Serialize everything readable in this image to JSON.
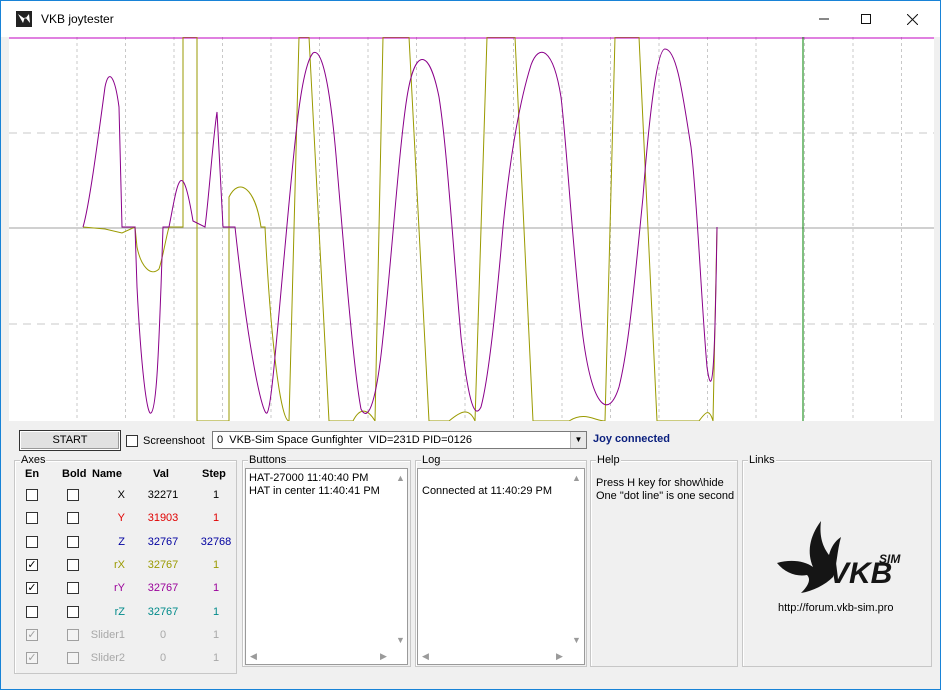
{
  "window": {
    "title": "VKB joytester",
    "minimize_glyph": "—",
    "maximize_glyph": "☐",
    "close_glyph": "✕"
  },
  "toolbar": {
    "start_label": "START",
    "screenshot_label": "Screenshoot",
    "device_value": "0  VKB-Sim Space Gunfighter  VID=231D PID=0126",
    "status": "Joy connected",
    "status_color": "#0a1f7e"
  },
  "axes": {
    "title": "Axes",
    "headers": {
      "en": "En",
      "bold": "Bold",
      "name": "Name",
      "val": "Val",
      "step": "Step"
    },
    "rows": [
      {
        "en": false,
        "bold": false,
        "name": "X",
        "val": "32271",
        "step": "1",
        "color": "#000000",
        "disabled": false
      },
      {
        "en": false,
        "bold": false,
        "name": "Y",
        "val": "31903",
        "step": "1",
        "color": "#e00000",
        "disabled": false
      },
      {
        "en": false,
        "bold": false,
        "name": "Z",
        "val": "32767",
        "step": "32768",
        "color": "#0000a0",
        "disabled": false
      },
      {
        "en": true,
        "bold": false,
        "name": "rX",
        "val": "32767",
        "step": "1",
        "color": "#9a9a00",
        "disabled": false
      },
      {
        "en": true,
        "bold": false,
        "name": "rY",
        "val": "32767",
        "step": "1",
        "color": "#9a009a",
        "disabled": false
      },
      {
        "en": false,
        "bold": false,
        "name": "rZ",
        "val": "32767",
        "step": "1",
        "color": "#008a8a",
        "disabled": false
      },
      {
        "en": true,
        "bold": false,
        "name": "Slider1",
        "val": "0",
        "step": "1",
        "color": "#a8a8a8",
        "disabled": true
      },
      {
        "en": true,
        "bold": false,
        "name": "Slider2",
        "val": "0",
        "step": "1",
        "color": "#a8a8a8",
        "disabled": true
      }
    ]
  },
  "buttons_panel": {
    "title": "Buttons",
    "lines": [
      "HAT-27000 11:40:40 PM",
      "HAT in center 11:40:41 PM"
    ]
  },
  "log_panel": {
    "title": "Log",
    "lines": [
      "Connected at 11:40:29 PM"
    ]
  },
  "help_panel": {
    "title": "Help",
    "lines": [
      "Press H key for show\\hide",
      "One \"dot line\" is one second"
    ]
  },
  "links_panel": {
    "title": "Links",
    "logo_text": "VKB",
    "logo_sup": "SIM",
    "url": "http://forum.vkb-sim.pro"
  },
  "plot": {
    "colors": {
      "series_rx": "#9a9a00",
      "series_ry": "#8a008a",
      "cursor": "#008000",
      "top_line": "#c000c0",
      "grid": "#c8c8c8"
    }
  },
  "icons": {
    "app": "vkb-bird-icon",
    "dropdown": "chevron-down-icon"
  }
}
